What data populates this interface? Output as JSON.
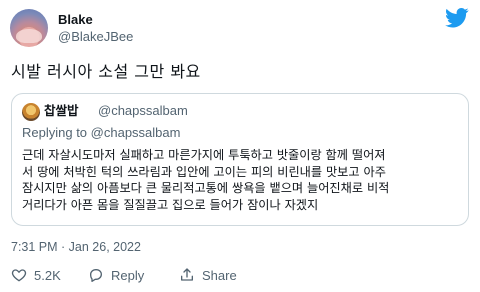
{
  "author": {
    "display_name": "Blake",
    "handle": "@BlakeJBee"
  },
  "brand_icon": "twitter-bird-icon",
  "brand_color": "#1d9bf0",
  "tweet": {
    "text": "시발 러시아 소설 그만 봐요"
  },
  "quoted": {
    "display_name": "찹쌀밥",
    "handle": "@chapssalbam",
    "replying_prefix": "Replying to ",
    "replying_to": "@chapssalbam",
    "lines": [
      "근데 자살시도마저 실패하고 마른가지에 투툭하고 밧줄이랑 함께 떨어져",
      "서 땅에 처박힌 턱의 쓰라림과 입안에 고이는 피의 비린내를 맛보고 아주",
      "잠시지만 삶의 아픔보다 큰 물리적고통에 쌍욕을 뱉으며 늘어진채로 비적",
      "거리다가 아픈 몸을 질질끌고 집으로 들어가 잠이나 자겠지"
    ]
  },
  "meta": {
    "timestamp": "7:31 PM · Jan 26, 2022"
  },
  "actions": {
    "like_icon": "heart-icon",
    "like_count": "5.2K",
    "reply_icon": "reply-bubble-icon",
    "reply_label": "Reply",
    "share_icon": "share-icon",
    "share_label": "Share"
  }
}
